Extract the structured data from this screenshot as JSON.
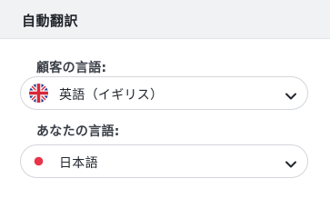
{
  "panel": {
    "title": "自動翻訳"
  },
  "customer_language": {
    "label": "顧客の言語:",
    "selected": "英語（イギリス）",
    "flag_icon": "uk-flag-icon"
  },
  "your_language": {
    "label": "あなたの言語:",
    "selected": "日本語",
    "flag_icon": "japan-flag-icon"
  },
  "colors": {
    "header_bg": "#f1f2f4",
    "border": "#d3d6db",
    "japan_red": "#e8334a",
    "uk_blue": "#1f3a8f",
    "uk_red": "#d6283b"
  }
}
